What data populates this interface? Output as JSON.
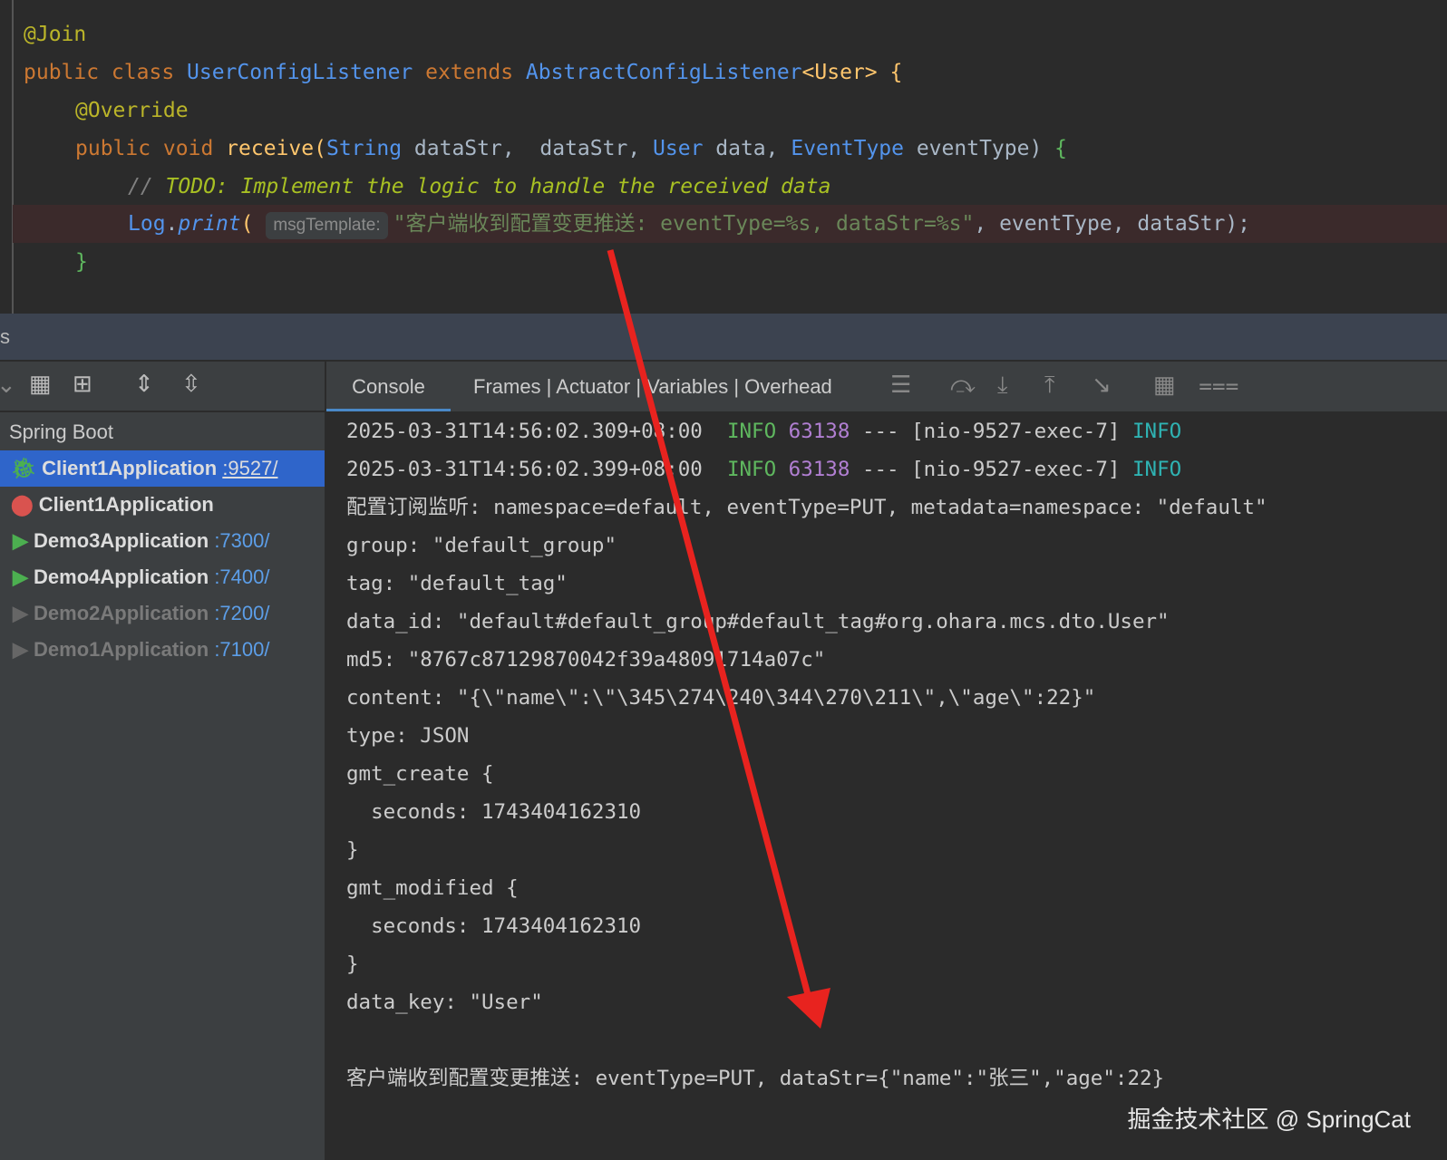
{
  "editor": {
    "lines": [
      {
        "annotation": "@Join"
      },
      {
        "kw1": "public class ",
        "cls": "UserConfigListener",
        "kw2": " extends ",
        "parent": "AbstractConfigListener",
        "gen": "<User>",
        "brace": " {"
      },
      {
        "annotation": "@Override"
      },
      {
        "kw": "public void ",
        "fn": "receive",
        "p1": "(",
        "t1": "String",
        " n1": " dataStr, ",
        "t2": "User",
        "n2": " data, ",
        "t3": "EventType",
        "n3": " eventType) ",
        "brace": "{"
      },
      {
        "comment": "// ",
        "todo": "TODO: Implement the logic to handle the received data"
      },
      {
        "obj": "Log",
        "dot": ".",
        "method": "print",
        "paren": "( ",
        "hint": "msgTemplate:",
        "str": "\"客户端收到配置变更推送: eventType=%s, dataStr=%s\"",
        "rest": ", eventType, dataStr);"
      },
      {
        "brace": "}"
      }
    ]
  },
  "panel": {
    "title": "s"
  },
  "sidebar": {
    "group": "Spring Boot",
    "items": [
      {
        "name": "Client1Application",
        "port": ":9527/",
        "status": "debug",
        "selected": true
      },
      {
        "name": "Client1Application",
        "port": "",
        "status": "error"
      },
      {
        "name": "Demo3Application",
        "port": ":7300/",
        "status": "running"
      },
      {
        "name": "Demo4Application",
        "port": ":7400/",
        "status": "running"
      },
      {
        "name": "Demo2Application",
        "port": ":7200/",
        "status": "stopped"
      },
      {
        "name": "Demo1Application",
        "port": ":7100/",
        "status": "stopped"
      }
    ]
  },
  "tabs": {
    "console": "Console",
    "other": "Frames | Actuator | Variables | Overhead"
  },
  "console": {
    "log1": {
      "ts": "2025-03-31T14:56:02.309+08:00",
      "level": "INFO",
      "pid": "63138",
      "sep": " --- ",
      "thread": "[nio-9527-exec-7]",
      "level2": "INFO"
    },
    "log2": {
      "ts": "2025-03-31T14:56:02.399+08:00",
      "level": "INFO",
      "pid": "63138",
      "sep": " --- ",
      "thread": "[nio-9527-exec-7]",
      "level2": "INFO"
    },
    "lines": [
      "配置订阅监听: namespace=default, eventType=PUT, metadata=namespace: \"default\"",
      "group: \"default_group\"",
      "tag: \"default_tag\"",
      "data_id: \"default#default_group#default_tag#org.ohara.mcs.dto.User\"",
      "md5: \"8767c87129870042f39a48091714a07c\"",
      "content: \"{\\\"name\\\":\\\"\\345\\274\\240\\344\\270\\211\\\",\\\"age\\\":22}\"",
      "type: JSON",
      "gmt_create {",
      "  seconds: 1743404162310",
      "}",
      "gmt_modified {",
      "  seconds: 1743404162310",
      "}",
      "data_key: \"User\"",
      "",
      "客户端收到配置变更推送: eventType=PUT, dataStr={\"name\":\"张三\",\"age\":22}"
    ]
  },
  "watermark": "掘金技术社区 @ SpringCat",
  "colors": {
    "arrow": "#e8231f",
    "selection": "#2f65ca"
  }
}
